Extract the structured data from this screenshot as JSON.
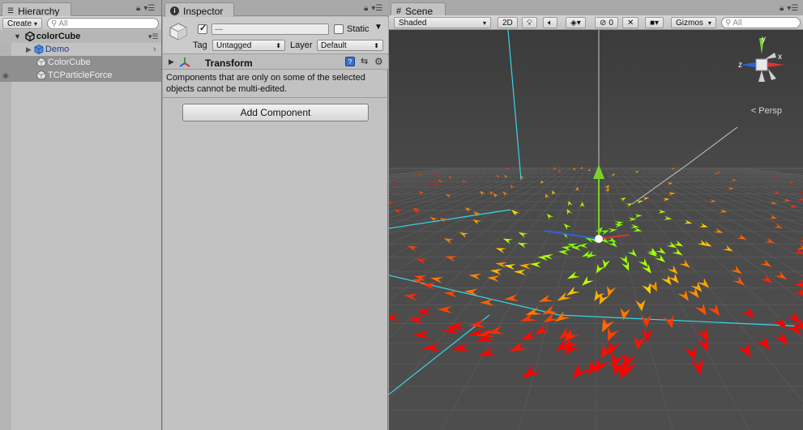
{
  "hierarchy": {
    "tab_label": "Hierarchy",
    "create_label": "Create",
    "search_placeholder": "All",
    "root": "colorCube",
    "items": [
      {
        "label": "Demo",
        "selected": false,
        "color": "#1b3c8e"
      },
      {
        "label": "ColorCube",
        "selected": true,
        "color": "#f0f0f0"
      },
      {
        "label": "TCParticleForce",
        "selected": true,
        "color": "#f0f0f0"
      }
    ]
  },
  "inspector": {
    "tab_label": "Inspector",
    "name_value": "—",
    "static_label": "Static",
    "tag_label": "Tag",
    "tag_value": "Untagged",
    "layer_label": "Layer",
    "layer_value": "Default",
    "component_title": "Transform",
    "multi_edit_note": "Components that are only on some of the selected objects cannot be multi-edited.",
    "add_component_label": "Add Component"
  },
  "scene": {
    "tab_label": "Scene",
    "shading_mode": "Shaded",
    "mode_2d_label": "2D",
    "hidden_count": "0",
    "gizmos_label": "Gizmos",
    "search_placeholder": "All",
    "projection_label": "Persp",
    "axis_labels": {
      "x": "x",
      "y": "y",
      "z": "z"
    },
    "colors": {
      "grid_bg": "#474747",
      "accent_cyan": "#35d6e6",
      "axis_x": "#e0332c",
      "axis_y": "#7bd12a",
      "axis_z": "#2e62e0"
    }
  }
}
